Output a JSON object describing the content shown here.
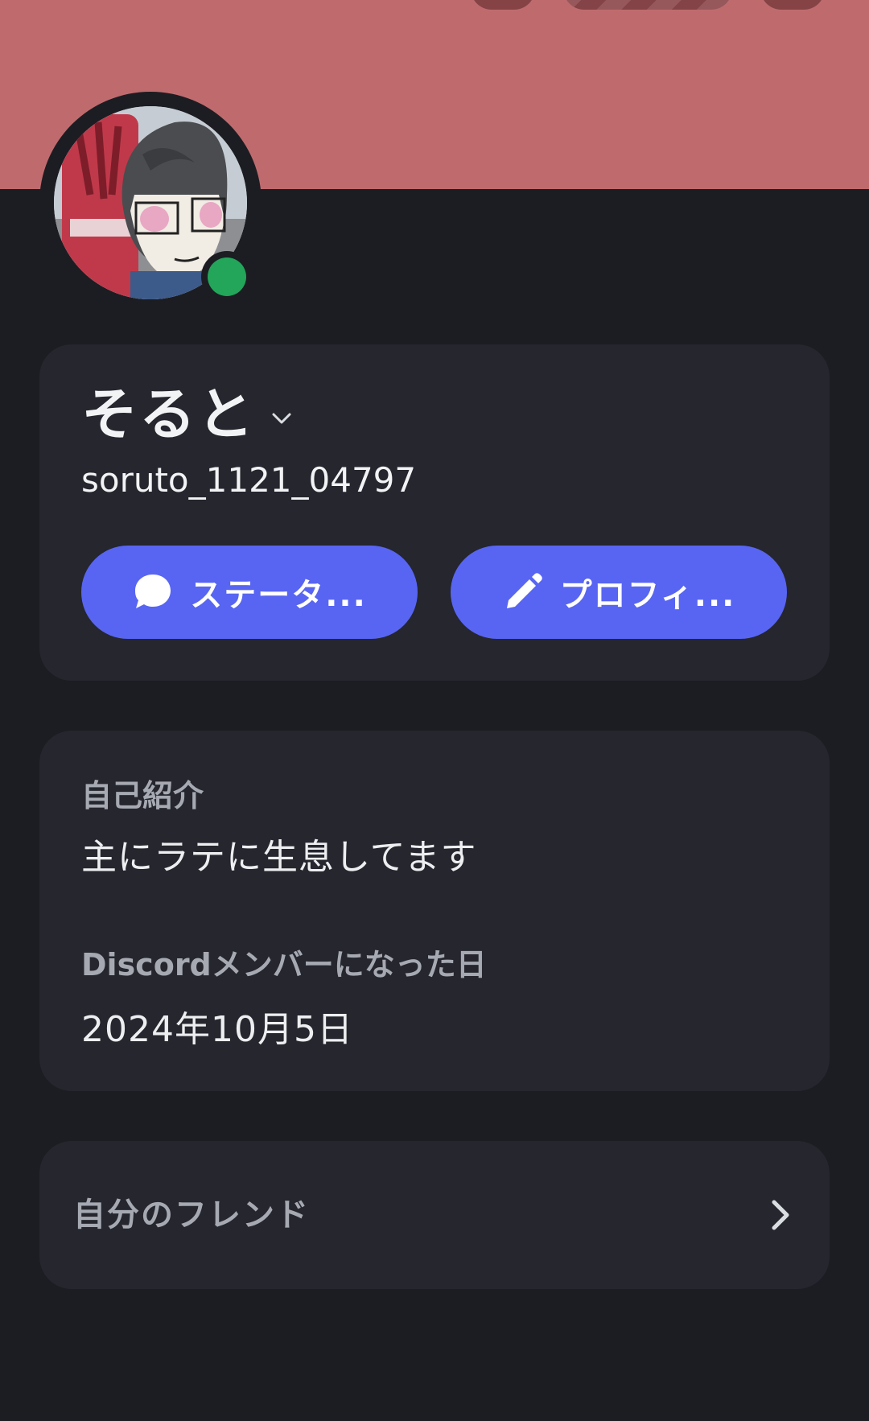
{
  "profile": {
    "display_name": "そると",
    "username": "soruto_1121_04797",
    "online_status": "online",
    "banner_color": "#bf6b6e",
    "avatar_icon": "profile-photo-avatar",
    "status_color": "#23a55a"
  },
  "actions": {
    "status_button": {
      "label": "ステータ...",
      "icon": "speech-bubble-icon"
    },
    "edit_profile_button": {
      "label": "プロフィ...",
      "icon": "pencil-icon"
    },
    "accent_color": "#5865f2"
  },
  "about": {
    "bio_label": "自己紹介",
    "bio_text": "主にラテに生息してます",
    "member_since_label": "Discordメンバーになった日",
    "member_since_value": "2024年10月5日"
  },
  "friends": {
    "label": "自分のフレンド",
    "icon": "chevron-right-icon"
  }
}
